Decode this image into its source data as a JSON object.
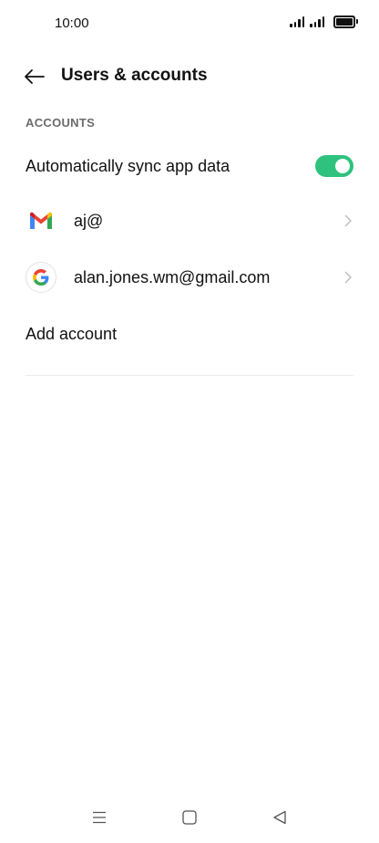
{
  "status_bar": {
    "time": "10:00",
    "icons": [
      "signal-icon",
      "signal-icon",
      "battery-icon"
    ]
  },
  "header": {
    "back_icon": "arrow-left-icon",
    "title": "Users & accounts"
  },
  "section": {
    "title": "ACCOUNTS"
  },
  "sync": {
    "label": "Automatically sync app data",
    "enabled": true,
    "accent_color": "#2ec27e"
  },
  "accounts": [
    {
      "icon": "gmail-icon",
      "label": "aj@"
    },
    {
      "icon": "google-icon",
      "label": "alan.jones.wm@gmail.com"
    }
  ],
  "add_account": {
    "label": "Add account"
  },
  "nav_bar": {
    "icons": [
      "menu-icon",
      "home-icon",
      "back-triangle-icon"
    ]
  }
}
